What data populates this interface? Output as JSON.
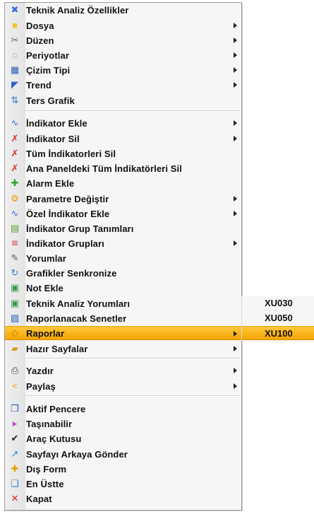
{
  "menu": {
    "items": [
      {
        "label": "Teknik Analiz Özellikler",
        "icon": "tools-icon",
        "glyph": "✖",
        "color": "#3a6fd8",
        "submenu": false
      },
      {
        "label": "Dosya",
        "icon": "folder-icon",
        "glyph": "■",
        "color": "#f2c230",
        "submenu": true
      },
      {
        "label": "Düzen",
        "icon": "edit-icon",
        "glyph": "✂",
        "color": "#6a6a6a",
        "submenu": true
      },
      {
        "label": "Periyotlar",
        "icon": "period-icon",
        "glyph": "◌",
        "color": "#2a7fd4",
        "submenu": true
      },
      {
        "label": "Çizim Tipi",
        "icon": "chart-type-icon",
        "glyph": "▦",
        "color": "#2a5fb4",
        "submenu": true
      },
      {
        "label": "Trend",
        "icon": "trend-icon",
        "glyph": "◤",
        "color": "#2f62c6",
        "submenu": true
      },
      {
        "label": "Ters Grafik",
        "icon": "invert-chart-icon",
        "glyph": "⇅",
        "color": "#2a7fd4",
        "submenu": false
      },
      {
        "label": "İndikator Ekle",
        "icon": "indicator-add-icon",
        "glyph": "∿",
        "color": "#3a6fd8",
        "submenu": true
      },
      {
        "label": "İndikator Sil",
        "icon": "indicator-delete-icon",
        "glyph": "✗",
        "color": "#d83030",
        "submenu": true
      },
      {
        "label": "Tüm İndikatorleri Sil",
        "icon": "indicator-delete-all-icon",
        "glyph": "✗",
        "color": "#d83030",
        "submenu": false
      },
      {
        "label": "Ana Paneldeki Tüm İndikatörleri Sil",
        "icon": "panel-indicator-delete-icon",
        "glyph": "✗",
        "color": "#d83030",
        "submenu": false
      },
      {
        "label": "Alarm Ekle",
        "icon": "alarm-add-icon",
        "glyph": "✚",
        "color": "#2ea02e",
        "submenu": false
      },
      {
        "label": "Parametre Değiştir",
        "icon": "parameter-icon",
        "glyph": "⚙",
        "color": "#e0a000",
        "submenu": true
      },
      {
        "label": "Özel İndikator Ekle",
        "icon": "custom-indicator-icon",
        "glyph": "∿",
        "color": "#3a6fd8",
        "submenu": true
      },
      {
        "label": "İndikator Grup Tanımları",
        "icon": "indicator-group-def-icon",
        "glyph": "▤",
        "color": "#5aa02e",
        "submenu": false
      },
      {
        "label": "İndikator Grupları",
        "icon": "indicator-groups-icon",
        "glyph": "≋",
        "color": "#d04040",
        "submenu": true
      },
      {
        "label": "Yorumlar",
        "icon": "comments-icon",
        "glyph": "✎",
        "color": "#606060",
        "submenu": false
      },
      {
        "label": "Grafikler Senkronize",
        "icon": "sync-icon",
        "glyph": "↻",
        "color": "#2a7fd4",
        "submenu": false
      },
      {
        "label": "Not Ekle",
        "icon": "note-add-icon",
        "glyph": "▣",
        "color": "#3a9a4a",
        "submenu": false
      },
      {
        "label": "Teknik Analiz Yorumları",
        "icon": "analysis-comments-icon",
        "glyph": "▣",
        "color": "#3a9a4a",
        "submenu": false
      },
      {
        "label": "Raporlanacak Senetler",
        "icon": "report-stocks-icon",
        "glyph": "▧",
        "color": "#2a5fb4",
        "submenu": false
      },
      {
        "label": "Raporlar",
        "icon": "reports-icon",
        "glyph": "◇",
        "color": "#c07a00",
        "submenu": true,
        "highlighted": true
      },
      {
        "label": "Hazır Sayfalar",
        "icon": "ready-pages-icon",
        "glyph": "▰",
        "color": "#d8a020",
        "submenu": true
      },
      {
        "label": "Yazdır",
        "icon": "printer-icon",
        "glyph": "⎙",
        "color": "#404040",
        "submenu": true
      },
      {
        "label": "Paylaş",
        "icon": "share-icon",
        "glyph": "<",
        "color": "#f0a000",
        "submenu": true
      },
      {
        "label": "Aktif Pencere",
        "icon": "active-window-icon",
        "glyph": "❐",
        "color": "#2a5fb4",
        "submenu": false
      },
      {
        "label": "Taşınabilir",
        "icon": "movable-icon",
        "glyph": "▸",
        "color": "#c040c0",
        "submenu": false
      },
      {
        "label": "Araç Kutusu",
        "icon": "checkmark-icon",
        "glyph": "✔",
        "color": "#202020",
        "submenu": false
      },
      {
        "label": "Sayfayı Arkaya Gönder",
        "icon": "send-back-icon",
        "glyph": "↗",
        "color": "#2a7fd4",
        "submenu": false
      },
      {
        "label": "Dış Form",
        "icon": "external-form-icon",
        "glyph": "✚",
        "color": "#e0a000",
        "submenu": false
      },
      {
        "label": "En Üstte",
        "icon": "on-top-icon",
        "glyph": "❏",
        "color": "#2a7fd4",
        "submenu": false
      },
      {
        "label": "Kapat",
        "icon": "close-icon",
        "glyph": "✕",
        "color": "#e02020",
        "submenu": false
      }
    ]
  },
  "submenu": {
    "items": [
      {
        "label": "XU030",
        "highlighted": false
      },
      {
        "label": "XU050",
        "highlighted": false
      },
      {
        "label": "XU100",
        "highlighted": true
      }
    ]
  }
}
